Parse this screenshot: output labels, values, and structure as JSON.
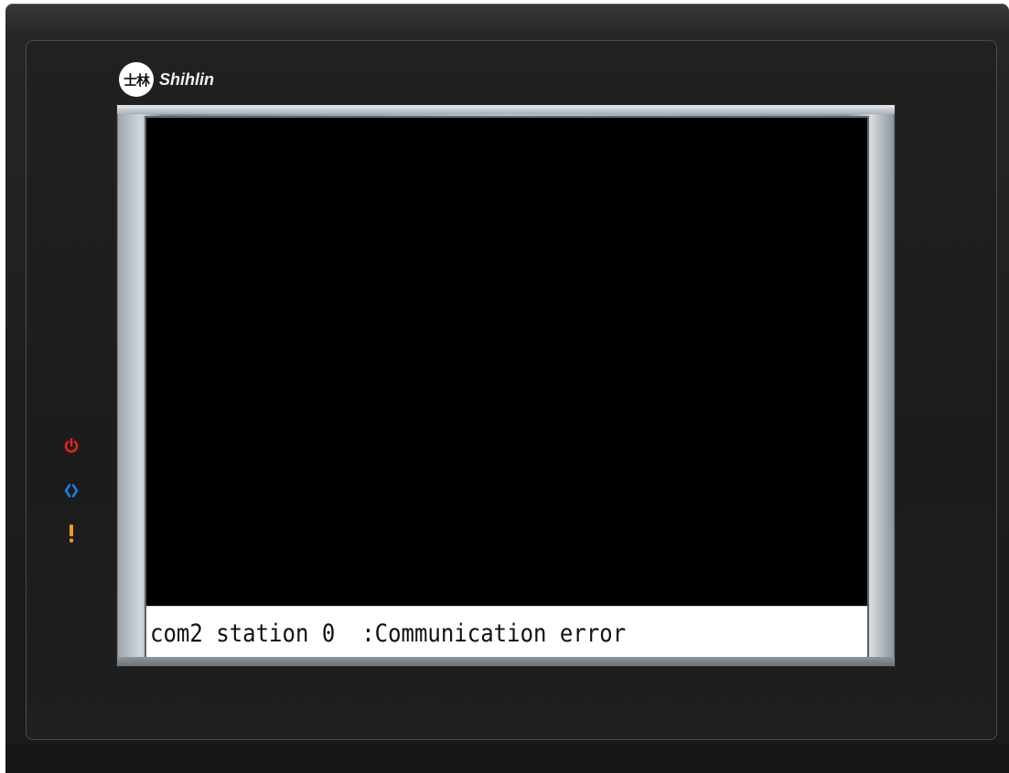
{
  "device": {
    "brand": "Shihlin",
    "logo_mark": "士林"
  },
  "screen": {
    "message": "com2 station 0  :Communication error"
  },
  "indicators": [
    {
      "name": "power-icon",
      "color": "#e0261f"
    },
    {
      "name": "communication-icon",
      "color": "#1e7fe0"
    },
    {
      "name": "alarm-icon",
      "color": "#f39a1e"
    }
  ]
}
